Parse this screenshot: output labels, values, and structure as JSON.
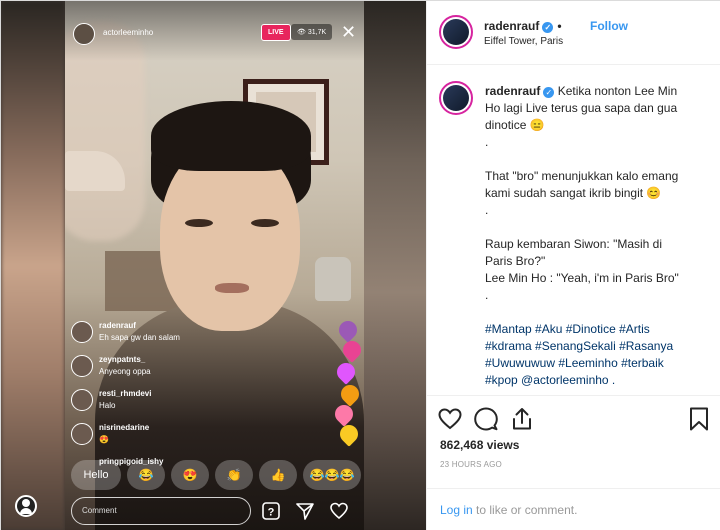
{
  "live_video": {
    "username": "actorleeminho",
    "live_label": "LIVE",
    "viewer_count": "31,7K",
    "comments": [
      {
        "name": "radenrauf",
        "text": "Eh sapa gw dan salam"
      },
      {
        "name": "zeynpatnts_",
        "text": "Anyeong oppa"
      },
      {
        "name": "resti_rhmdevi",
        "text": "Halo"
      },
      {
        "name": "nisrinedarine",
        "text": "😍"
      },
      {
        "name": "pringpigoid_ishy",
        "text": ""
      }
    ],
    "reactions": [
      "Hello",
      "😂",
      "😍",
      "👏",
      "👍",
      "😂😂😂"
    ],
    "comment_placeholder": "Comment",
    "heart_colors": [
      "#9b59b6",
      "#e84393",
      "#f39c12",
      "#e056fd",
      "#fd79a8",
      "#f9ca24"
    ]
  },
  "post": {
    "username": "radenrauf",
    "follow_label": "Follow",
    "location": "Eiffel Tower, Paris",
    "caption_lines": [
      "Ketika nonton Lee Min",
      "Ho lagi Live terus gua sapa dan gua",
      "dinotice 😑",
      ".",
      "That \"bro\" menunjukkan kalo emang",
      "kami sudah sangat ikrib bingit 😊",
      ".",
      "",
      "Raup kembaran Siwon: \"Masih di",
      "Paris Bro?\"",
      "Lee Min Ho : \"Yeah, i'm in Paris Bro\"",
      "."
    ],
    "hashtag_lines": [
      "#Mantap #Aku #Dinotice #Artis",
      "#kdrama #SenangSekali #Rasanya",
      "#Uwuwuwuw #Leeminho #terbaik",
      "#kpop @actorleeminho ."
    ],
    "trailing": ".",
    "views": "862,468 views",
    "time_ago": "23 HOURS AGO",
    "login_link": "Log in",
    "login_rest": " to like or comment."
  },
  "accent_colors": {
    "link": "#3897f0",
    "hashtag": "#003569",
    "live": "#e8255d"
  }
}
